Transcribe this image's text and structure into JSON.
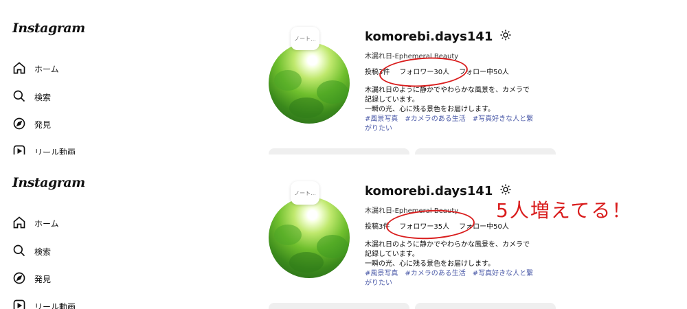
{
  "app": {
    "logo": "Instagram"
  },
  "nav": [
    {
      "label": "ホーム",
      "icon": "home-icon"
    },
    {
      "label": "検索",
      "icon": "search-icon"
    },
    {
      "label": "発見",
      "icon": "compass-icon"
    },
    {
      "label": "リール動画",
      "icon": "reels-icon"
    }
  ],
  "before": {
    "note": "ノート...",
    "username": "komorebi.days141",
    "fullname": "木漏れ日-Ephemeral Beauty",
    "posts": "投稿3件",
    "followers": "フォロワー30人",
    "following": "フォロー中50人",
    "bio_line1": "木漏れ日のように静かでやわらかな風景を、カメラで",
    "bio_line2": "記録しています。",
    "bio_line3": "一瞬の光、心に残る景色をお届けします。",
    "tags_line1": "#風景写真　#カメラのある生活　#写真好きな人と繋",
    "tags_line2": "がりたい"
  },
  "after": {
    "note": "ノート...",
    "username": "komorebi.days141",
    "fullname": "木漏れ日-Ephemeral Beauty",
    "posts": "投稿3件",
    "followers": "フォロワー35人",
    "following": "フォロー中50人",
    "bio_line1": "木漏れ日のように静かでやわらかな風景を、カメラで",
    "bio_line2": "記録しています。",
    "bio_line3": "一瞬の光、心に残る景色をお届けします。",
    "tags_line1": "#風景写真　#カメラのある生活　#写真好きな人と繋",
    "tags_line2": "がりたい"
  },
  "annotation": "5人増えてる！",
  "colors": {
    "annotation": "#d91d1d",
    "hashtag": "#4b5aa8",
    "button": "#efefef"
  }
}
